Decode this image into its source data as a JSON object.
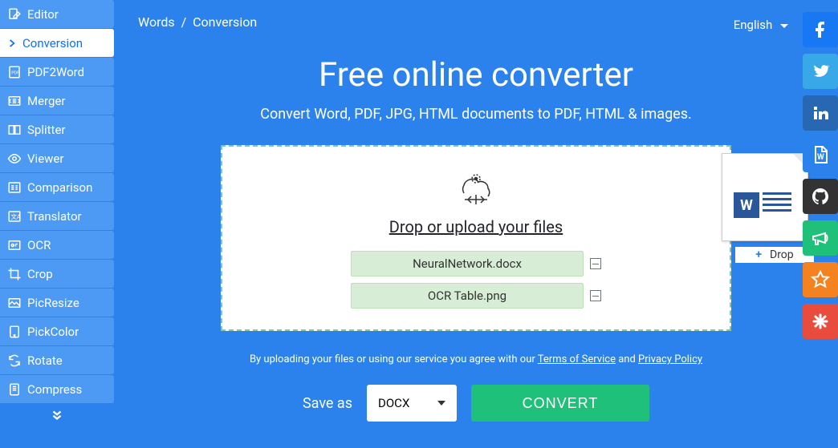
{
  "sidebar": {
    "items": [
      {
        "label": "Editor"
      },
      {
        "label": "Conversion"
      },
      {
        "label": "PDF2Word"
      },
      {
        "label": "Merger"
      },
      {
        "label": "Splitter"
      },
      {
        "label": "Viewer"
      },
      {
        "label": "Comparison"
      },
      {
        "label": "Translator"
      },
      {
        "label": "OCR"
      },
      {
        "label": "Crop"
      },
      {
        "label": "PicResize"
      },
      {
        "label": "PickColor"
      },
      {
        "label": "Rotate"
      },
      {
        "label": "Compress"
      }
    ]
  },
  "breadcrumb": {
    "a": "Words",
    "sep": "/",
    "b": "Conversion"
  },
  "language": "English",
  "title": "Free online converter",
  "subtitle": "Convert Word, PDF, JPG, HTML documents to PDF, HTML & images.",
  "dropzone": {
    "label": "Drop or upload your files",
    "files": [
      {
        "name": "NeuralNetwork.docx"
      },
      {
        "name": "OCR Table.png"
      }
    ],
    "drop_hint": "Drop"
  },
  "agree": {
    "prefix": "By uploading your files or using our service you agree with our ",
    "tos": "Terms of Service",
    "mid": " and ",
    "pp": "Privacy Policy"
  },
  "convert": {
    "saveas": "Save as",
    "format": "DOCX",
    "button": "CONVERT"
  },
  "social": {
    "colors": {
      "fb": "#1877f2",
      "tw": "#38a8e8",
      "li": "#2867b2",
      "doc": "#2c82ed",
      "gh": "#333333",
      "horn": "#1ec07a",
      "star": "#f58220",
      "sun": "#e74c3c"
    }
  }
}
